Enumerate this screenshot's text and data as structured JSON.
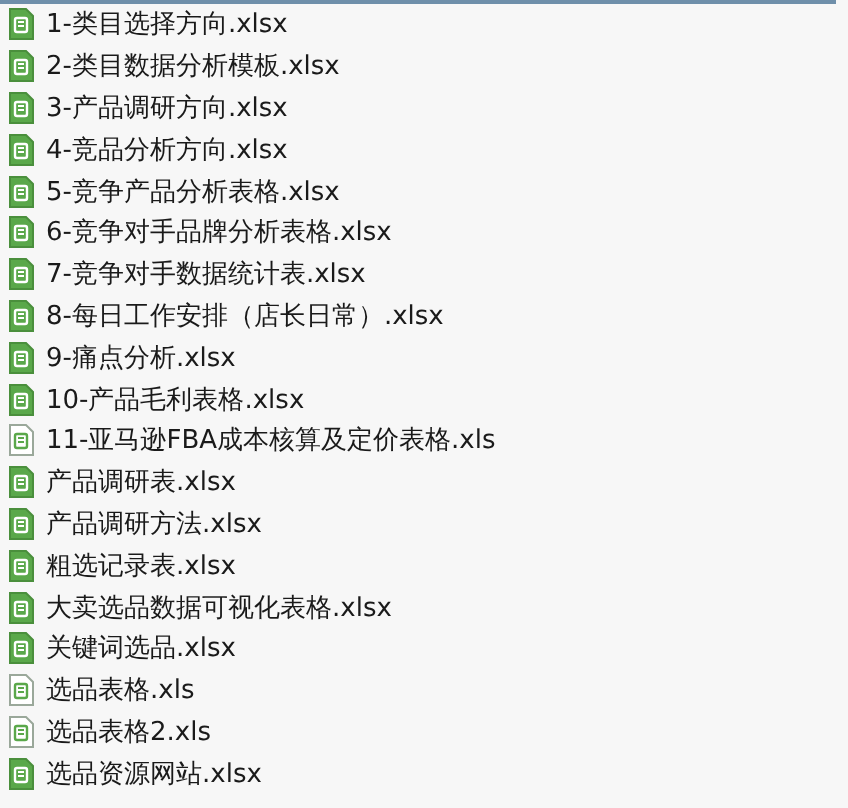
{
  "files": [
    {
      "name": "1-类目选择方向.xlsx",
      "kind": "xlsx"
    },
    {
      "name": "2-类目数据分析模板.xlsx",
      "kind": "xlsx"
    },
    {
      "name": "3-产品调研方向.xlsx",
      "kind": "xlsx"
    },
    {
      "name": "4-竞品分析方向.xlsx",
      "kind": "xlsx"
    },
    {
      "name": "5-竞争产品分析表格.xlsx",
      "kind": "xlsx"
    },
    {
      "name": "6-竞争对手品牌分析表格.xlsx",
      "kind": "xlsx"
    },
    {
      "name": "7-竞争对手数据统计表.xlsx",
      "kind": "xlsx"
    },
    {
      "name": "8-每日工作安排（店长日常）.xlsx",
      "kind": "xlsx"
    },
    {
      "name": "9-痛点分析.xlsx",
      "kind": "xlsx"
    },
    {
      "name": "10-产品毛利表格.xlsx",
      "kind": "xlsx"
    },
    {
      "name": "11-亚马逊FBA成本核算及定价表格.xls",
      "kind": "xls"
    },
    {
      "name": "产品调研表.xlsx",
      "kind": "xlsx"
    },
    {
      "name": "产品调研方法.xlsx",
      "kind": "xlsx"
    },
    {
      "name": "粗选记录表.xlsx",
      "kind": "xlsx"
    },
    {
      "name": "大卖选品数据可视化表格.xlsx",
      "kind": "xlsx"
    },
    {
      "name": "关键词选品.xlsx",
      "kind": "xlsx"
    },
    {
      "name": "选品表格.xls",
      "kind": "xls"
    },
    {
      "name": "选品表格2.xls",
      "kind": "xls"
    },
    {
      "name": "选品资源网站.xlsx",
      "kind": "xlsx"
    }
  ]
}
